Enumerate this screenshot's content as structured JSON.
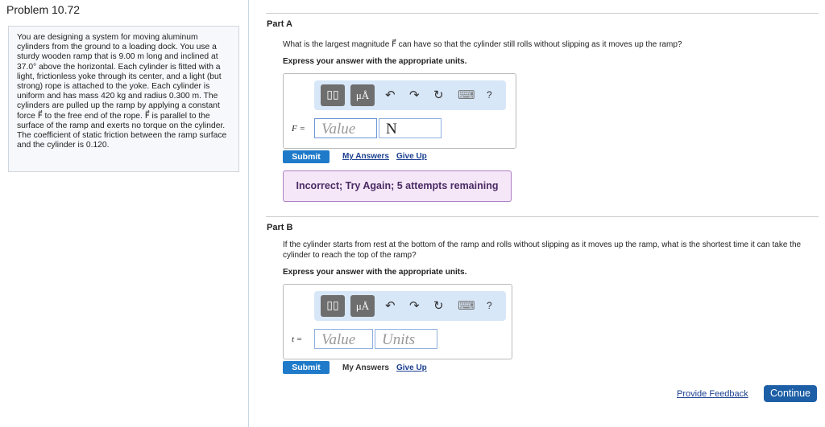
{
  "problem": {
    "title": "Problem 10.72",
    "text": "You are designing a system for moving aluminum cylinders from the ground to a loading dock. You use a sturdy wooden ramp that is 9.00 m long and inclined at 37.0° above the horizontal. Each cylinder is fitted with a light, frictionless yoke through its center, and a light (but strong) rope is attached to the yoke. Each cylinder is uniform and has mass 420 kg and radius 0.300 m. The cylinders are pulled up the ramp by applying a constant force F⃗ to the free end of the rope. F⃗ is parallel to the surface of the ramp and exerts no torque on the cylinder. The coefficient of static friction between the ramp surface and the cylinder is 0.120."
  },
  "toolbar": {
    "templates": "▯▯",
    "units": "μÅ",
    "undo": "↶",
    "redo": "↷",
    "reset": "↻",
    "keyboard": "⌨",
    "help": "?"
  },
  "partA": {
    "label": "Part A",
    "question": "What is the largest magnitude F⃗ can have so that the cylinder still rolls without slipping as it moves up the ramp?",
    "express": "Express your answer with the appropriate units.",
    "var": "F =",
    "value_placeholder": "Value",
    "units_value": "N",
    "submit": "Submit",
    "my_answers": "My Answers",
    "give_up": "Give Up",
    "feedback": "Incorrect; Try Again; 5 attempts remaining"
  },
  "partB": {
    "label": "Part B",
    "question": "If the cylinder starts from rest at the bottom of the ramp and rolls without slipping as it moves up the ramp, what is the shortest time it can take the cylinder to reach the top of the ramp?",
    "express": "Express your answer with the appropriate units.",
    "var": "t =",
    "value_placeholder": "Value",
    "units_placeholder": "Units",
    "submit": "Submit",
    "my_answers": "My Answers",
    "give_up": "Give Up"
  },
  "footer": {
    "provide_feedback": "Provide Feedback",
    "continue": "Continue"
  }
}
